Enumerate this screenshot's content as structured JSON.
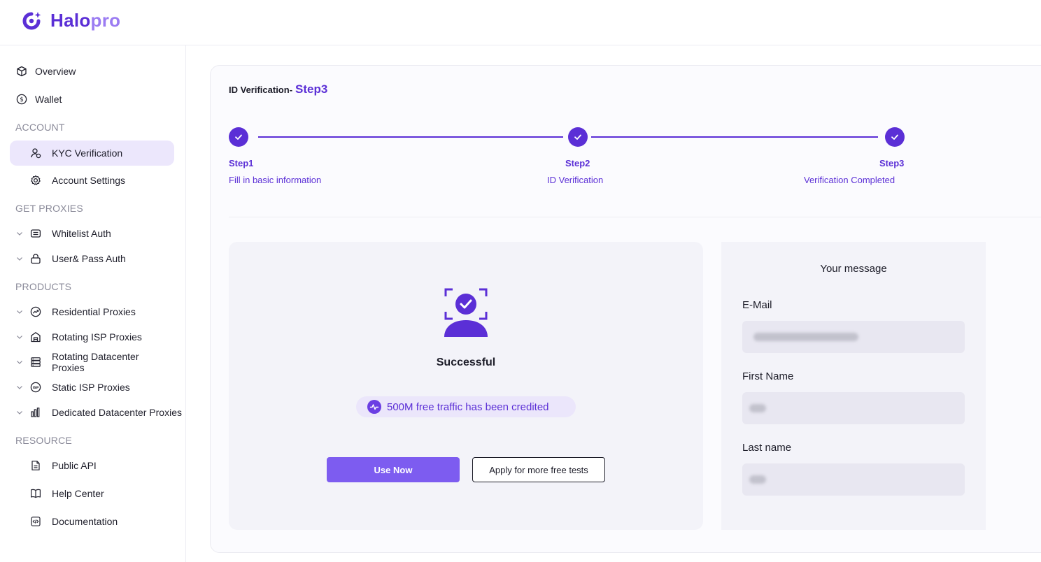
{
  "brand": {
    "name_part1": "Halo",
    "name_part2": "pro",
    "primary_color": "#5b2fd6",
    "accent_color": "#9b7cf2"
  },
  "sidebar": {
    "overview": "Overview",
    "wallet": "Wallet",
    "section_account": "ACCOUNT",
    "kyc": "KYC Verification",
    "account_settings": "Account Settings",
    "section_get_proxies": "GET PROXIES",
    "whitelist": "Whitelist Auth",
    "userpass": "User& Pass Auth",
    "section_products": "PRODUCTS",
    "residential": "Residential Proxies",
    "rotating_isp": "Rotating ISP Proxies",
    "rotating_dc": "Rotating Datacenter Proxies",
    "static_isp": "Static ISP Proxies",
    "dedicated_dc": "Dedicated Datacenter Proxies",
    "section_resource": "RESOURCE",
    "public_api": "Public API",
    "help_center": "Help Center",
    "documentation": "Documentation"
  },
  "page": {
    "title_prefix": "ID Verification-",
    "title_step": "Step3"
  },
  "steps": [
    {
      "label": "Step1",
      "desc": "Fill in basic information"
    },
    {
      "label": "Step2",
      "desc": "ID Verification"
    },
    {
      "label": "Step3",
      "desc": "Verification Completed"
    }
  ],
  "success": {
    "status": "Successful",
    "traffic": "500M free traffic has been credited",
    "use_now": "Use Now",
    "apply_more": "Apply for more free tests"
  },
  "message": {
    "title": "Your message",
    "email_label": "E-Mail",
    "first_name_label": "First Name",
    "last_name_label": "Last name"
  }
}
